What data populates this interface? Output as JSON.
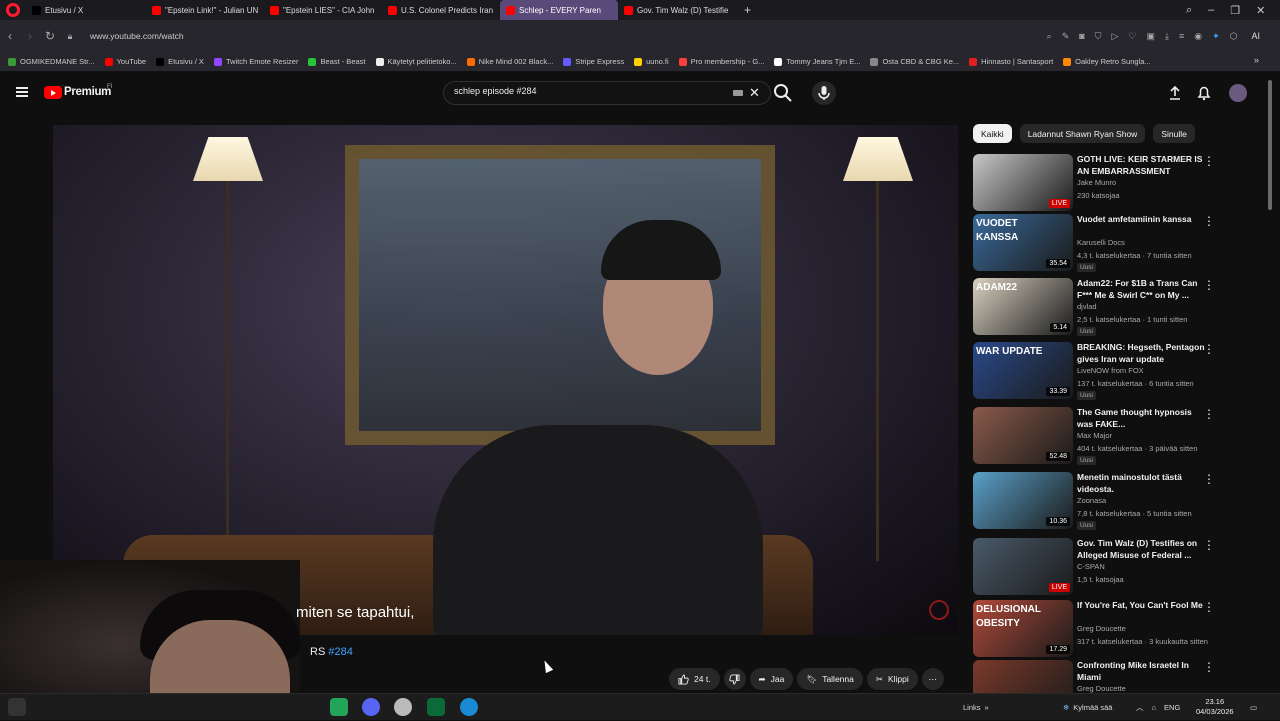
{
  "browser": {
    "tabs": [
      {
        "label": "Etusivu / X",
        "fav": "#000000"
      },
      {
        "label": "\"Epstein Link!\" - Julian UN",
        "fav": "#ff0000"
      },
      {
        "label": "\"Epstein LIES\" - CIA John",
        "fav": "#ff0000"
      },
      {
        "label": "U.S. Colonel Predicts Iran",
        "fav": "#ff0000"
      },
      {
        "label": "Schlep - EVERY Paren",
        "fav": "#ff0000",
        "active": true
      },
      {
        "label": "Gov. Tim Walz (D) Testifie",
        "fav": "#ff0000"
      }
    ],
    "new_tab": "+",
    "url": "www.youtube.com/watch",
    "ai_label": "AI",
    "bookmarks": [
      {
        "label": "OGMIKEDMANE Str...",
        "fav": "#3a9a3a"
      },
      {
        "label": "YouTube",
        "fav": "#ff0000"
      },
      {
        "label": "Etusivu / X",
        "fav": "#000000"
      },
      {
        "label": "Twitch Emote Resizer",
        "fav": "#9146ff"
      },
      {
        "label": "Beast - Beast",
        "fav": "#27c43a"
      },
      {
        "label": "Käytetyt pelitietoko...",
        "fav": "#eeeeee"
      },
      {
        "label": "Nike Mind 002 Black...",
        "fav": "#ff6a00"
      },
      {
        "label": "Stripe Express",
        "fav": "#635bff"
      },
      {
        "label": "uuno.fi",
        "fav": "#ffd000"
      },
      {
        "label": "Pro membership - G...",
        "fav": "#ff3d3d"
      },
      {
        "label": "Tommy Jeans Tjm E...",
        "fav": "#ffffff"
      },
      {
        "label": "Osta CBD & CBG Ke...",
        "fav": "#888888"
      },
      {
        "label": "Hinnasto | Santasport",
        "fav": "#e02020"
      },
      {
        "label": "Oakley Retro Sungla...",
        "fav": "#ff8800"
      }
    ]
  },
  "youtube": {
    "brand": "Premium",
    "region": "FI",
    "search_value": "schlep episode #284",
    "subtitle_line": "miten se tapahtui,",
    "subtitle_ep_prefix": "RS ",
    "subtitle_ep_tag": "#284",
    "actions": {
      "like_count": "24 t.",
      "share": "Jaa",
      "save": "Tallenna",
      "clip": "Klippi"
    },
    "chips": [
      "Kaikki",
      "Ladannut Shawn Ryan Show",
      "Sinulle"
    ],
    "recommendations": [
      {
        "title": "GOTH LIVE: KEIR STARMER IS AN EMBARRASSMENT",
        "channel": "Jake Munro",
        "meta": "230 katsojaa",
        "duration": "LIVE",
        "live": true,
        "badge": "",
        "thumb": "#c8c8c8"
      },
      {
        "title": "Vuodet amfetamiinin kanssa",
        "channel": "Karuselli Docs",
        "meta": "4,3 t. katselukertaa · 7 tuntia sitten",
        "duration": "35.54",
        "live": false,
        "badge": "Uusi",
        "thumb": "#3a6a9a"
      },
      {
        "title": "Adam22: For $1B a Trans Can F*** Me & Swirl C** on My ...",
        "channel": "djvlad",
        "meta": "2,5 t. katselukertaa · 1 tunti sitten",
        "duration": "5.14",
        "live": false,
        "badge": "Uusi",
        "thumb": "#d8d0c0"
      },
      {
        "title": "BREAKING: Hegseth, Pentagon gives Iran war update",
        "channel": "LiveNOW from FOX",
        "meta": "137 t. katselukertaa · 6 tuntia sitten",
        "duration": "33.39",
        "live": false,
        "badge": "Uusi",
        "thumb": "#2a4a8a"
      },
      {
        "title": "The Game thought hypnosis was FAKE...",
        "channel": "Max Major",
        "meta": "404 t. katselukertaa · 3 päivää sitten",
        "duration": "52.48",
        "live": false,
        "badge": "Uusi",
        "thumb": "#8a5a4a"
      },
      {
        "title": "Menetin mainostulot tästä videosta.",
        "channel": "Zoonasa",
        "meta": "7,8 t. katselukertaa · 5 tuntia sitten",
        "duration": "10.36",
        "live": false,
        "badge": "Uusi",
        "thumb": "#5aa0c8"
      },
      {
        "title": "Gov. Tim Walz (D) Testifies on Alleged Misuse of Federal ...",
        "channel": "C-SPAN",
        "meta": "1,5 t. katsojaa",
        "duration": "LIVE",
        "live": true,
        "badge": "",
        "thumb": "#4a5a6a"
      },
      {
        "title": "If You're Fat, You Can't Fool Me",
        "channel": "Greg Doucette",
        "meta": "317 t. katselukertaa · 3 kuukautta sitten",
        "duration": "17.29",
        "live": false,
        "badge": "",
        "thumb": "#b04a3a"
      },
      {
        "title": "Confronting Mike Israetel In Miami",
        "channel": "Greg Doucette",
        "meta": "",
        "duration": "",
        "live": false,
        "badge": "",
        "thumb": "#7a3a2a"
      }
    ],
    "thumb_texts": [
      "VUODET",
      "KANSSA",
      "ADAM22",
      "WAR UPDATE",
      "DELUSIONAL",
      "OBESITY"
    ]
  },
  "taskbar": {
    "links_label": "Links",
    "weather": "Kylmää sää",
    "language": "ENG",
    "time": "23.16",
    "date": "04/03/2026"
  }
}
